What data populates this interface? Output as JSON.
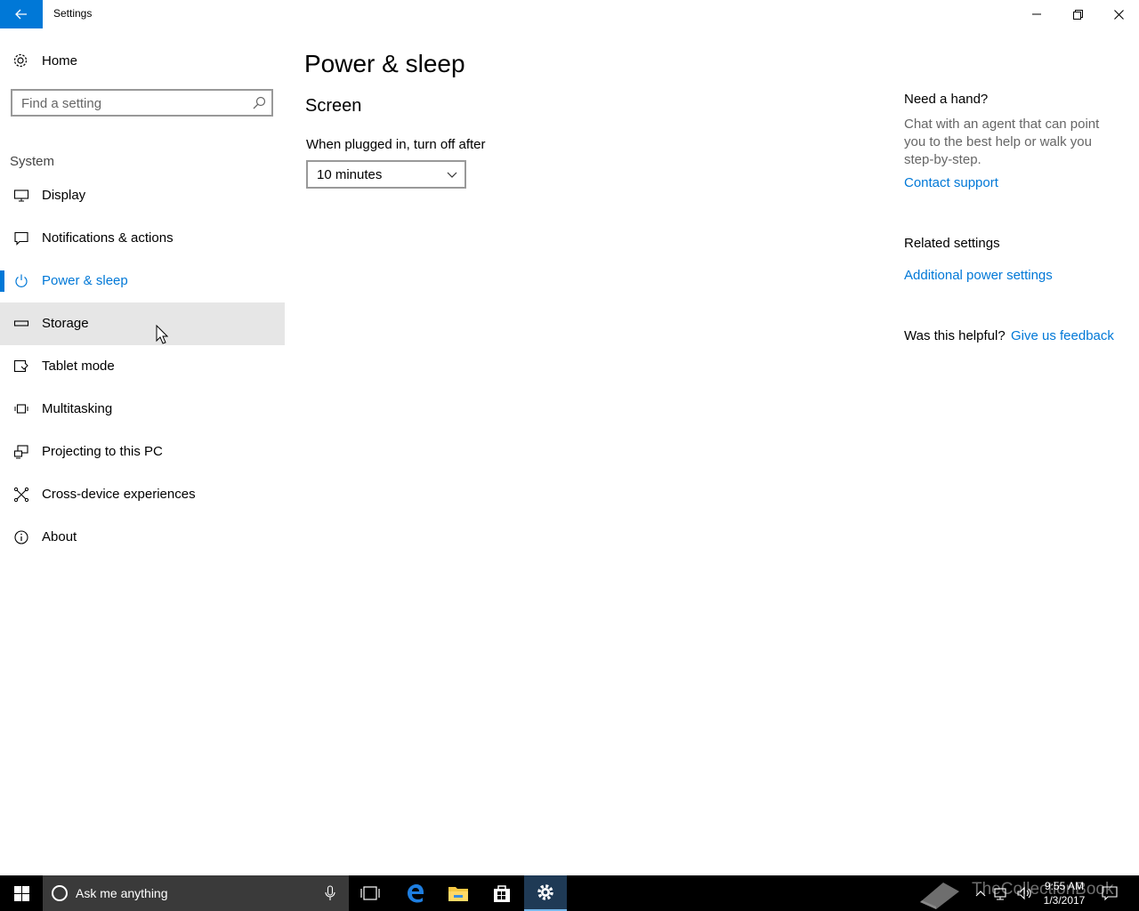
{
  "window": {
    "title": "Settings"
  },
  "sidebar": {
    "home_label": "Home",
    "search_placeholder": "Find a setting",
    "group_label": "System",
    "items": [
      {
        "label": "Display"
      },
      {
        "label": "Notifications & actions"
      },
      {
        "label": "Power & sleep",
        "active": true
      },
      {
        "label": "Storage",
        "hovered": true
      },
      {
        "label": "Tablet mode"
      },
      {
        "label": "Multitasking"
      },
      {
        "label": "Projecting to this PC"
      },
      {
        "label": "Cross-device experiences"
      },
      {
        "label": "About"
      }
    ]
  },
  "main": {
    "title": "Power & sleep",
    "section": "Screen",
    "plugged_label": "When plugged in, turn off after",
    "plugged_value": "10 minutes"
  },
  "help": {
    "heading": "Need a hand?",
    "text": "Chat with an agent that can point you to the best help or walk you step-by-step.",
    "contact_link": "Contact support",
    "related_heading": "Related settings",
    "related_link": "Additional power settings",
    "helpful_label": "Was this helpful?",
    "feedback_link": "Give us feedback"
  },
  "taskbar": {
    "search_text": "Ask me anything",
    "time": "9:55 AM",
    "date": "1/3/2017",
    "watermark": "TheCollectionBook"
  },
  "colors": {
    "accent": "#0078d7",
    "hover": "#e6e6e6",
    "taskbar": "#000000"
  }
}
